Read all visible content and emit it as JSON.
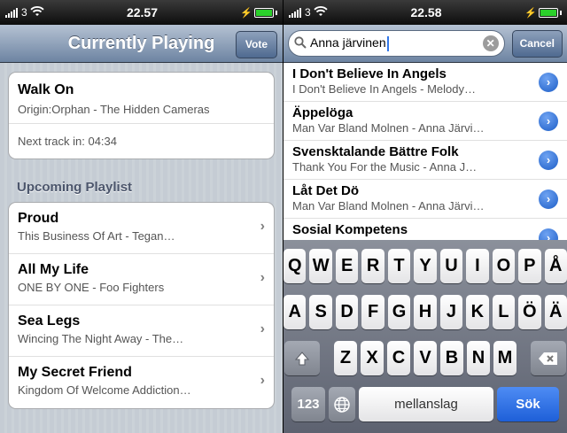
{
  "left": {
    "status": {
      "carrier": "3",
      "time": "22.57"
    },
    "nav": {
      "title": "Currently Playing",
      "vote_label": "Vote"
    },
    "now_playing": {
      "title": "Walk On",
      "subtitle": "Origin:Orphan - The Hidden Cameras",
      "next_track": "Next track in: 04:34"
    },
    "section_title": "Upcoming Playlist",
    "playlist": [
      {
        "title": "Proud",
        "subtitle": "This Business Of Art - Tegan…"
      },
      {
        "title": "All My Life",
        "subtitle": "ONE BY ONE - Foo Fighters"
      },
      {
        "title": "Sea Legs",
        "subtitle": "Wincing The Night Away - The…"
      },
      {
        "title": "My Secret Friend",
        "subtitle": "Kingdom Of Welcome Addiction…"
      }
    ]
  },
  "right": {
    "status": {
      "carrier": "3",
      "time": "22.58"
    },
    "search": {
      "value": "Anna järvinen",
      "cancel_label": "Cancel"
    },
    "results": [
      {
        "title": "I Don't Believe In Angels",
        "subtitle": "I Don't Believe In Angels - Melody…"
      },
      {
        "title": "Äppelöga",
        "subtitle": "Man Var Bland Molnen - Anna Järvi…"
      },
      {
        "title": "Svensktalande Bättre Folk",
        "subtitle": "Thank You For the Music - Anna J…"
      },
      {
        "title": "Låt Det Dö",
        "subtitle": "Man Var Bland Molnen - Anna Järvi…"
      },
      {
        "title": "Sosial Kompetens",
        "subtitle": ""
      }
    ],
    "keyboard": {
      "row1": [
        "Q",
        "W",
        "E",
        "R",
        "T",
        "Y",
        "U",
        "I",
        "O",
        "P",
        "Å"
      ],
      "row2": [
        "A",
        "S",
        "D",
        "F",
        "G",
        "H",
        "J",
        "K",
        "L",
        "Ö",
        "Ä"
      ],
      "row3": [
        "Z",
        "X",
        "C",
        "V",
        "B",
        "N",
        "M"
      ],
      "numbers_label": "123",
      "space_label": "mellanslag",
      "search_label": "Sök"
    }
  },
  "colors": {
    "nav_gradient_top": "#b5c2d3",
    "nav_gradient_bottom": "#6d84a2",
    "accent": "#1e5fd8",
    "battery": "#2bd02b"
  }
}
